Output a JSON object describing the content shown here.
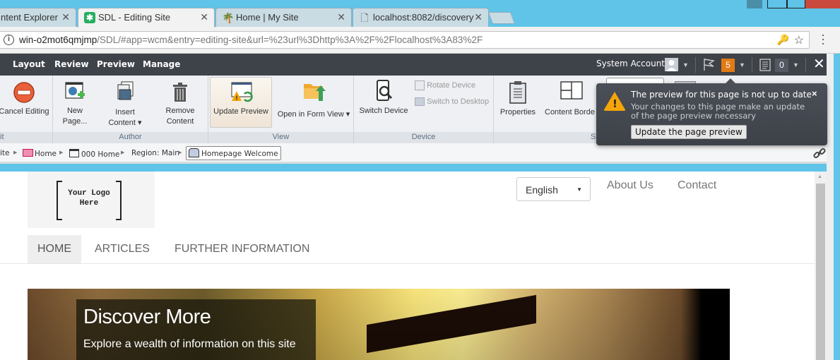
{
  "browser": {
    "tabs": [
      {
        "title": "ntent Explorer",
        "icon": "page-icon",
        "active": false
      },
      {
        "title": "SDL - Editing Site",
        "icon": "sdl-logo-icon",
        "active": true
      },
      {
        "title": "Home | My Site",
        "icon": "palm-tree-icon",
        "active": false
      },
      {
        "title": "localhost:8082/discovery",
        "icon": "document-icon",
        "active": false
      }
    ],
    "close_glyph": "✕",
    "url_host": "win-o2mot6qmjmp",
    "url_rest": "/SDL/#app=wcm&entry=editing-site&url=%23url%3Dhttp%3A%2F%2Flocalhost%3A83%2F",
    "info_glyph": "i",
    "key_glyph": "🔑",
    "star_glyph": "☆",
    "menu_glyph": "⋮"
  },
  "sdl_bar": {
    "tabs": [
      "Layout",
      "Review",
      "Preview",
      "Manage"
    ],
    "account": "System Account",
    "notifications_count": "5",
    "clipboard_count": "0",
    "close_glyph": "✕",
    "caret_glyph": "▼"
  },
  "ribbon": {
    "groups": [
      {
        "label": "it",
        "buttons": [
          {
            "label": "Cancel Editing",
            "icon": "cancel-icon"
          }
        ]
      },
      {
        "label": "Author",
        "buttons": [
          {
            "label": "New Page...",
            "icon": "new-page-icon"
          },
          {
            "label": "Insert Content",
            "icon": "insert-content-icon",
            "dropdown": true
          },
          {
            "label": "Remove Content",
            "icon": "trash-icon"
          }
        ]
      },
      {
        "label": "View",
        "buttons": [
          {
            "label": "Update Preview",
            "icon": "update-preview-icon",
            "highlighted": true
          },
          {
            "label": "Open in Form View",
            "icon": "folder-open-icon",
            "dropdown": true
          }
        ]
      },
      {
        "label": "Device",
        "buttons": [
          {
            "label": "Switch Device",
            "icon": "switch-device-icon"
          },
          {
            "label": "Rotate Device",
            "icon": "rotate-device-icon",
            "disabled": true
          },
          {
            "label": "Switch to Desktop",
            "icon": "switch-desktop-icon",
            "disabled": true
          }
        ]
      },
      {
        "label": "S",
        "buttons": [
          {
            "label": "Properties",
            "icon": "properties-icon"
          },
          {
            "label": "Content Borde",
            "icon": "content-borders-icon"
          }
        ]
      }
    ]
  },
  "breadcrumb": [
    {
      "label": "ite",
      "icon": null
    },
    {
      "label": "Home",
      "icon": "folder-icon"
    },
    {
      "label": "000 Home",
      "icon": "page-icon"
    },
    {
      "label": "Region: Main",
      "icon": null
    },
    {
      "label": "Homepage Welcome",
      "icon": "component-icon",
      "selected": true
    }
  ],
  "popup": {
    "title": "The preview for this page is not up to date",
    "body": "Your changes to this page make an update of the page preview necessary",
    "button": "Update the page preview",
    "close_glyph": "×",
    "warn_glyph": "!"
  },
  "site": {
    "logo_text_line1": "Your Logo",
    "logo_text_line2": "Here",
    "language": "English",
    "top_links": [
      "About Us",
      "Contact"
    ],
    "nav": [
      "HOME",
      "ARTICLES",
      "FURTHER INFORMATION"
    ],
    "active_nav": "HOME",
    "hero_title": "Discover More",
    "hero_subtitle": "Explore a wealth of information on this site"
  }
}
